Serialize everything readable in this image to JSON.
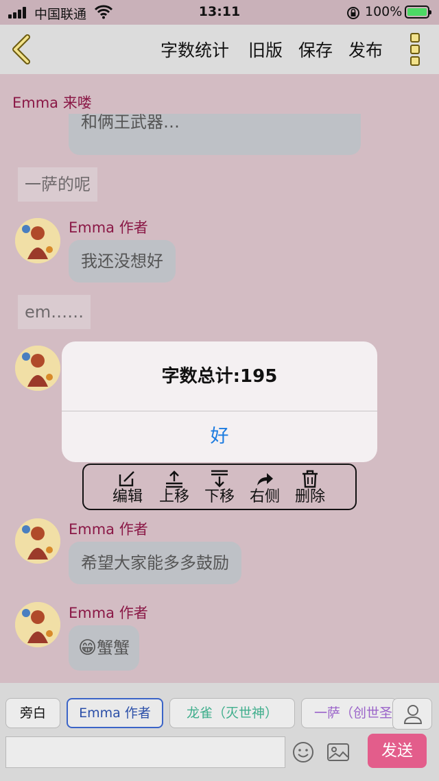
{
  "status_bar": {
    "carrier": "中国联通",
    "time": "13:11",
    "battery": "100%"
  },
  "header": {
    "actions": [
      "字数统计",
      "旧版",
      "保存",
      "发布"
    ]
  },
  "chat": {
    "top_name": "Emma 来喽",
    "partial_bubble": "和俩王武器…",
    "aside_1": "一萨的呢",
    "msg1_name": "Emma 作者",
    "msg1_text": "我还没想好",
    "aside_2": "em……",
    "msg3_name": "Emma 作者",
    "msg3_text": "希望大家能多多鼓励",
    "msg4_name": "Emma 作者",
    "msg4_emoji": "😁",
    "msg4_text": "蟹蟹"
  },
  "dialog": {
    "title": "字数总计:195",
    "ok": "好"
  },
  "context_menu": {
    "items": [
      "编辑",
      "上移",
      "下移",
      "右侧",
      "删除"
    ]
  },
  "bottom": {
    "roles": [
      "旁白",
      "Emma 作者",
      "龙雀（灭世神）",
      "一萨（创世圣"
    ],
    "input_value": "",
    "send": "发送"
  },
  "colors": {
    "name": "#8a1846",
    "send": "#e35d8b",
    "dialog_ok": "#1b7be0",
    "role_active": "#3a63c7",
    "role_longque": "#3fae8c",
    "role_yisa": "#9a63c9"
  }
}
